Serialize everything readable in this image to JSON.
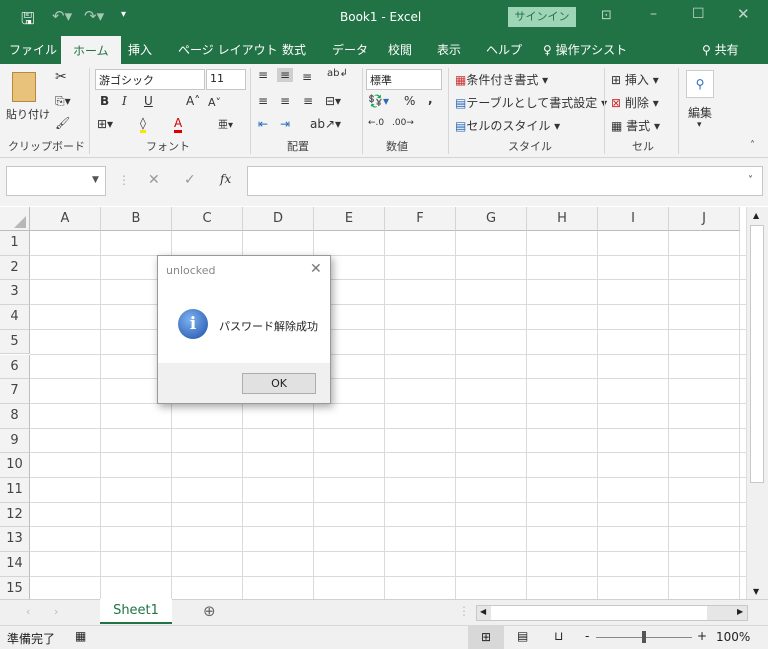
{
  "window": {
    "title": "Book1  -  Excel",
    "signin": "サインイン"
  },
  "tabs": [
    "ファイル",
    "ホーム",
    "挿入",
    "ページ レイアウト",
    "数式",
    "データ",
    "校閲",
    "表示",
    "ヘルプ",
    "操作アシスト"
  ],
  "share": "共有",
  "ribbon": {
    "clipboard": {
      "paste": "貼り付け",
      "label": "クリップボード"
    },
    "font": {
      "name": "游ゴシック",
      "size": "11",
      "label": "フォント",
      "bold": "B",
      "italic": "I",
      "underline": "U"
    },
    "alignment": {
      "label": "配置"
    },
    "number": {
      "format": "標準",
      "percent": "%",
      "comma": ",",
      "label": "数値"
    },
    "styles": {
      "conditional": "条件付き書式",
      "table": "テーブルとして書式設定",
      "cell": "セルのスタイル",
      "label": "スタイル"
    },
    "cells": {
      "insert": "挿入",
      "delete": "削除",
      "format": "書式",
      "label": "セル"
    },
    "editing": {
      "label": "編集"
    }
  },
  "formula_bar": {
    "name_box": "",
    "fx": "fx",
    "value": ""
  },
  "grid": {
    "columns": [
      "A",
      "B",
      "C",
      "D",
      "E",
      "F",
      "G",
      "H",
      "I",
      "J"
    ],
    "rows": [
      "1",
      "2",
      "3",
      "4",
      "5",
      "6",
      "7",
      "8",
      "9",
      "10",
      "11",
      "12",
      "13",
      "14",
      "15"
    ]
  },
  "sheets": {
    "tabs": [
      "Sheet1"
    ]
  },
  "status": {
    "ready": "準備完了",
    "zoom": "100%"
  },
  "dialog": {
    "title": "unlocked",
    "message": "パスワード解除成功",
    "ok": "OK"
  }
}
